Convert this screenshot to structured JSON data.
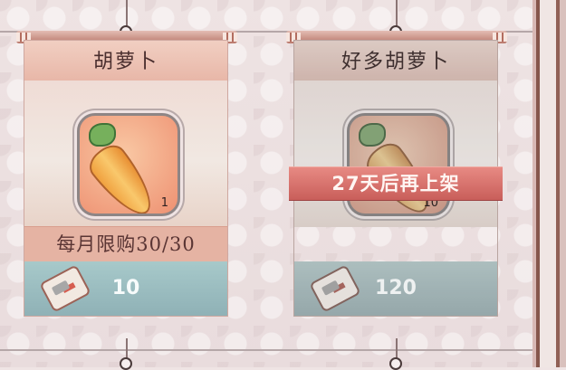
{
  "shop": {
    "items": [
      {
        "name": "胡萝卜",
        "quantity": "1",
        "limit_text": "每月限购30/30",
        "price": "10"
      },
      {
        "name": "好多胡萝卜",
        "quantity": "10",
        "restock_text": "27天后再上架",
        "price": "120"
      }
    ]
  },
  "colors": {
    "title_bg": "#e8b7a8",
    "limit_bg": "#e5b3a3",
    "price_bg": "#8fb1b6",
    "restock_bg": "#c85d59"
  },
  "icons": {
    "item": "carrot-icon",
    "currency": "ticket-icon"
  }
}
